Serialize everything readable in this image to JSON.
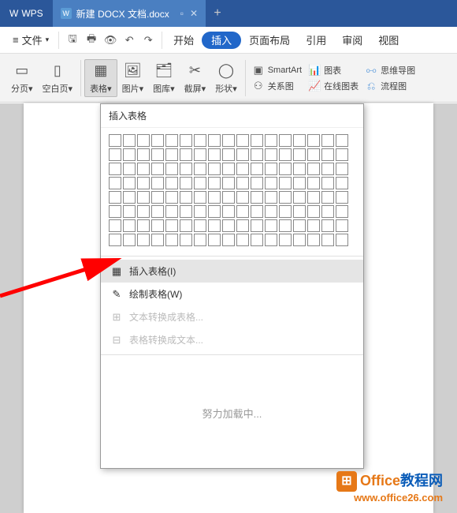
{
  "app": {
    "name": "WPS"
  },
  "tab": {
    "title": "新建 DOCX 文档.docx"
  },
  "file_menu": {
    "label": "文件"
  },
  "ribbon_tabs": {
    "start": "开始",
    "insert": "插入",
    "layout": "页面布局",
    "ref": "引用",
    "review": "审阅",
    "view": "视图"
  },
  "toolbar": {
    "page_break": "分页",
    "blank_page": "空白页",
    "table": "表格",
    "picture": "图片",
    "gallery": "图库",
    "screenshot": "截屏",
    "shapes": "形状",
    "smartart": "SmartArt",
    "chart": "图表",
    "relation_chart": "关系图",
    "online_chart": "在线图表",
    "mindmap": "思维导图",
    "flowchart": "流程图"
  },
  "dropdown": {
    "header": "插入表格",
    "insert_table": "插入表格(I)",
    "draw_table": "绘制表格(W)",
    "text_to_table": "文本转换成表格...",
    "table_to_text": "表格转换成文本...",
    "loading": "努力加载中..."
  },
  "watermark": {
    "brand1": "Office",
    "brand2": "教程网",
    "url": "www.office26.com"
  }
}
